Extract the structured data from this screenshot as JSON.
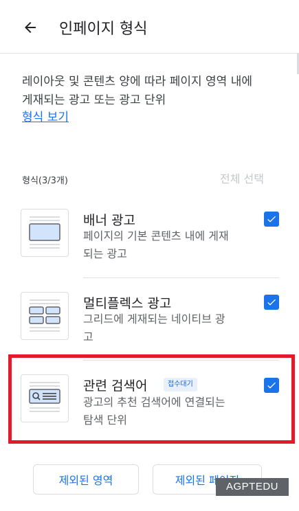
{
  "header": {
    "back_icon": "arrow-back-icon",
    "title": "인페이지 형식"
  },
  "intro": {
    "description_line1": "레이아웃 및 콘텐츠 양에 따라 페이지 영역 내에",
    "description_line2": "게재되는 광고 또는 광고 단위",
    "link": "형식 보기"
  },
  "formats": {
    "label": "형식(3/3개)",
    "select_all": "전체 선택",
    "items": [
      {
        "title": "배너 광고",
        "desc_line1": "페이지의 기본 콘텐츠 내에 게재",
        "desc_line2": "되는 광고",
        "checked": true,
        "icon": "banner-ad-icon"
      },
      {
        "title": "멀티플렉스 광고",
        "desc_line1": "그리드에 게재되는 네이티브 광",
        "desc_line2": "고",
        "checked": true,
        "icon": "multiplex-ad-icon"
      },
      {
        "title": "관련 검색어",
        "badge": "접수대기",
        "desc_line1": "광고의 추천 검색어에 연결되는",
        "desc_line2": "탐색 단위",
        "checked": true,
        "icon": "related-search-icon"
      }
    ]
  },
  "footer": {
    "excluded_areas": "제외된 영역",
    "excluded_pages": "제외된 페이지"
  },
  "watermark": "AGPTEDU",
  "colors": {
    "accent": "#1a73e8",
    "highlight": "#e21b2a"
  }
}
